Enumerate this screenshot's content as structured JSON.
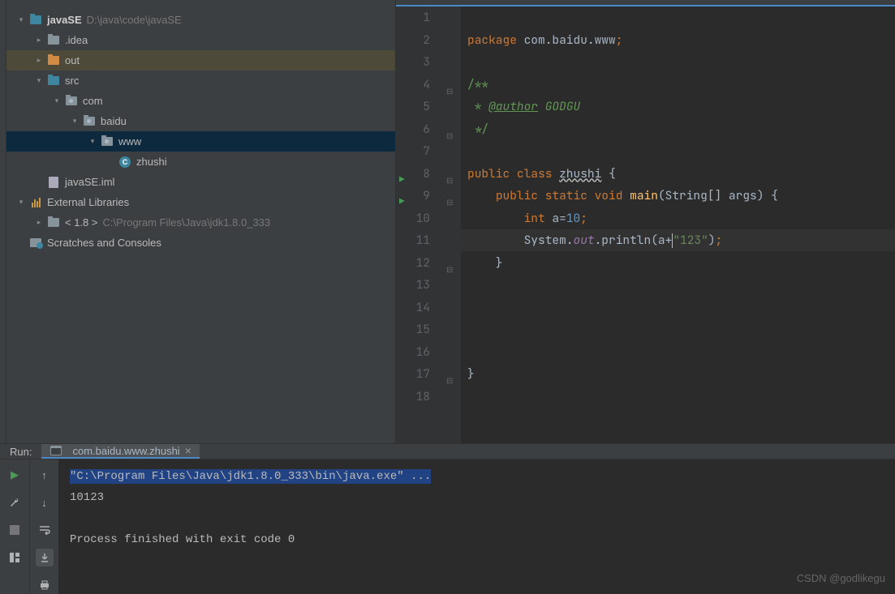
{
  "project": {
    "root": {
      "name": "javaSE",
      "path": "D:\\java\\code\\javaSE"
    },
    "nodes": [
      {
        "indent": 0,
        "arrow": "down",
        "icon": "folder-src",
        "label": "javaSE",
        "bold": true,
        "hint": "D:\\java\\code\\javaSE"
      },
      {
        "indent": 1,
        "arrow": "right",
        "icon": "folder",
        "label": ".idea"
      },
      {
        "indent": 1,
        "arrow": "right",
        "icon": "folder-out",
        "label": "out",
        "highlight": true
      },
      {
        "indent": 1,
        "arrow": "down",
        "icon": "folder-src",
        "label": "src"
      },
      {
        "indent": 2,
        "arrow": "down",
        "icon": "folder-pkg",
        "label": "com"
      },
      {
        "indent": 3,
        "arrow": "down",
        "icon": "folder-pkg",
        "label": "baidu"
      },
      {
        "indent": 4,
        "arrow": "down",
        "icon": "folder-pkg",
        "label": "www",
        "selected": true
      },
      {
        "indent": 5,
        "arrow": "",
        "icon": "class",
        "label": "zhushi"
      },
      {
        "indent": 1,
        "arrow": "",
        "icon": "file",
        "label": "javaSE.iml"
      },
      {
        "indent": 0,
        "arrow": "down",
        "icon": "lib",
        "label": "External Libraries"
      },
      {
        "indent": 1,
        "arrow": "right",
        "icon": "folder",
        "label": "< 1.8 >",
        "hint": "C:\\Program Files\\Java\\jdk1.8.0_333"
      },
      {
        "indent": 0,
        "arrow": "",
        "icon": "scratch",
        "label": "Scratches and Consoles"
      }
    ]
  },
  "editor": {
    "tokens": [
      [],
      [
        {
          "t": "kw",
          "v": "package "
        },
        {
          "t": "",
          "v": "com.baidu.www"
        },
        {
          "t": "kw",
          "v": ";"
        }
      ],
      [],
      [
        {
          "t": "doc",
          "v": "/**"
        }
      ],
      [
        {
          "t": "doc",
          "v": " * "
        },
        {
          "t": "tag",
          "v": "@author"
        },
        {
          "t": "cmt",
          "v": " GODGU"
        }
      ],
      [
        {
          "t": "doc",
          "v": " */"
        }
      ],
      [],
      [
        {
          "t": "kw",
          "v": "public class "
        },
        {
          "t": "underline-wavy",
          "v": "zhushi"
        },
        {
          "t": "",
          "v": " {"
        }
      ],
      [
        {
          "t": "",
          "v": "    "
        },
        {
          "t": "kw",
          "v": "public static void "
        },
        {
          "t": "fn",
          "v": "main"
        },
        {
          "t": "",
          "v": "(String[] args) {"
        }
      ],
      [
        {
          "t": "",
          "v": "        "
        },
        {
          "t": "kw",
          "v": "int "
        },
        {
          "t": "",
          "v": "a="
        },
        {
          "t": "num",
          "v": "10"
        },
        {
          "t": "kw",
          "v": ";"
        }
      ],
      [
        {
          "t": "",
          "v": "        System."
        },
        {
          "t": "field",
          "v": "out"
        },
        {
          "t": "",
          "v": ".println(a+"
        },
        {
          "t": "caret",
          "v": ""
        },
        {
          "t": "str",
          "v": "\"123\""
        },
        {
          "t": "",
          "v": ")"
        },
        {
          "t": "kw",
          "v": ";"
        }
      ],
      [
        {
          "t": "",
          "v": "    }"
        }
      ],
      [],
      [],
      [],
      [],
      [
        {
          "t": "",
          "v": "}"
        }
      ],
      []
    ],
    "run_markers": [
      8,
      9
    ],
    "fold_open": [
      4,
      8,
      9
    ],
    "fold_close": [
      6,
      12,
      17
    ],
    "cursor_line": 11
  },
  "run": {
    "label": "Run:",
    "tab": "com.baidu.www.zhushi",
    "lines": [
      "\"C:\\Program Files\\Java\\jdk1.8.0_333\\bin\\java.exe\" ...",
      "10123",
      "",
      "Process finished with exit code 0"
    ]
  },
  "watermark": "CSDN @godlikegu"
}
